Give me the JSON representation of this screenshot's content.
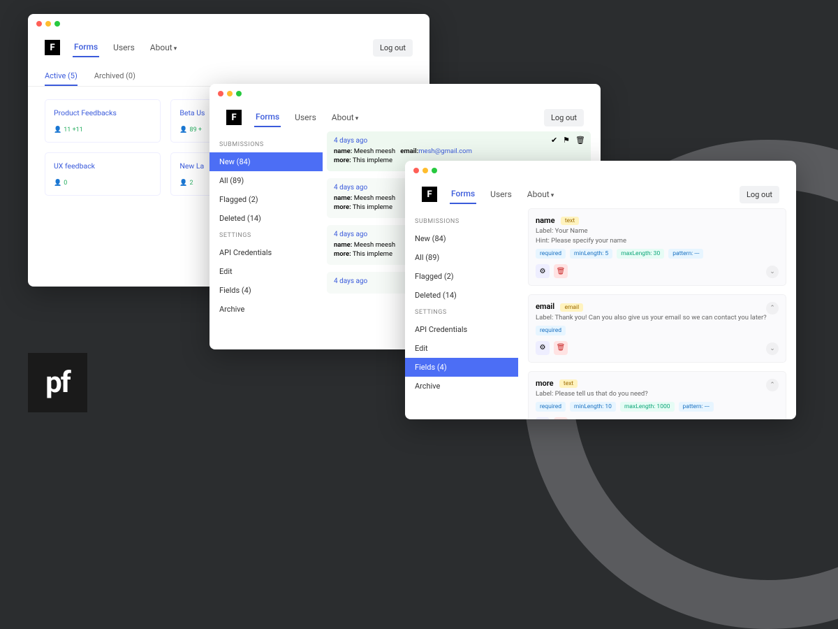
{
  "brand_letter": "F",
  "nav": {
    "forms": "Forms",
    "users": "Users",
    "about": "About"
  },
  "logout": "Log out",
  "pf_logo": "pf",
  "w1": {
    "tabs": {
      "active": "Active (5)",
      "archived": "Archived (0)"
    },
    "cards": [
      {
        "title": "Product Feedbacks",
        "count": "11 +11"
      },
      {
        "title": "Beta Us",
        "count": "89 +"
      },
      {
        "title": "UX feedback",
        "count": "0"
      },
      {
        "title": "New La",
        "count": "2"
      }
    ]
  },
  "w2": {
    "sections": {
      "submissions": "SUBMISSIONS",
      "settings": "SETTINGS"
    },
    "sidebar_sub": [
      "New (84)",
      "All (89)",
      "Flagged (2)",
      "Deleted (14)"
    ],
    "sidebar_set": [
      "API Credentials",
      "Edit",
      "Fields (4)",
      "Archive"
    ],
    "sub_date": "4 days ago",
    "sub_name_label": "name:",
    "sub_name_val": " Meesh meesh",
    "sub_email_label": "email:",
    "sub_email_val": "mesh@gmail.com",
    "sub_more_label": "more:",
    "sub_more_val": " This impleme"
  },
  "w3": {
    "sections": {
      "submissions": "SUBMISSIONS",
      "settings": "SETTINGS"
    },
    "sidebar_sub": [
      "New (84)",
      "All (89)",
      "Flagged (2)",
      "Deleted (14)"
    ],
    "sidebar_set": [
      "API Credentials",
      "Edit",
      "Fields (4)",
      "Archive"
    ],
    "fields": [
      {
        "name": "name",
        "type": "text",
        "label": "Label: Your Name",
        "hint": "Hint: Please specify your name",
        "badges": {
          "req": "required",
          "min": "minLength: 5",
          "max": "maxLength: 30",
          "pat": "pattern: ---"
        }
      },
      {
        "name": "email",
        "type": "email",
        "label": "Label: Thank you! Can you also give us your email so we can contact you later?",
        "badges": {
          "req": "required"
        }
      },
      {
        "name": "more",
        "type": "text",
        "label": "Label: Please tell us that do you need?",
        "badges": {
          "req": "required",
          "min": "minLength: 10",
          "max": "maxLength: 1000",
          "pat": "pattern: ---"
        }
      }
    ]
  }
}
